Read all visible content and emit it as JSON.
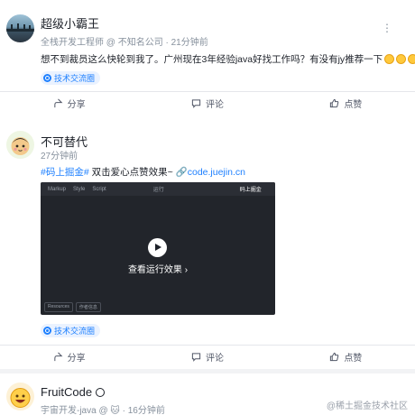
{
  "posts": [
    {
      "author": "超级小霸王",
      "title": "全栈开发工程师",
      "company": "不知名公司",
      "time": "21分钟前",
      "content": "想不到裁员这么快轮到我了。广州现在3年经验java好找工作吗？有没有jy推荐一下",
      "tag": "技术交流圈"
    },
    {
      "author": "不可替代",
      "time": "27分钟前",
      "hashtag": "#码上掘金#",
      "content": " 双击爱心点赞效果~ ",
      "link": "code.juejin.cn",
      "video": {
        "tabs": [
          "Markup",
          "Style",
          "Script"
        ],
        "run_label": "运行",
        "brand": "码上掘金",
        "play_label": "查看运行效果 ›",
        "bottom_tabs": [
          "Resources",
          "作者信息"
        ]
      },
      "tag": "技术交流圈"
    },
    {
      "author": "FruitCode",
      "title": "宇宙开发-java",
      "time": "16分钟前"
    }
  ],
  "actions": {
    "share": "分享",
    "comment": "评论",
    "like": "点赞"
  },
  "watermark": "@稀土掘金技术社区",
  "colors": {
    "accent": "#1e80ff",
    "text": "#1d2129",
    "muted": "#86909c"
  }
}
